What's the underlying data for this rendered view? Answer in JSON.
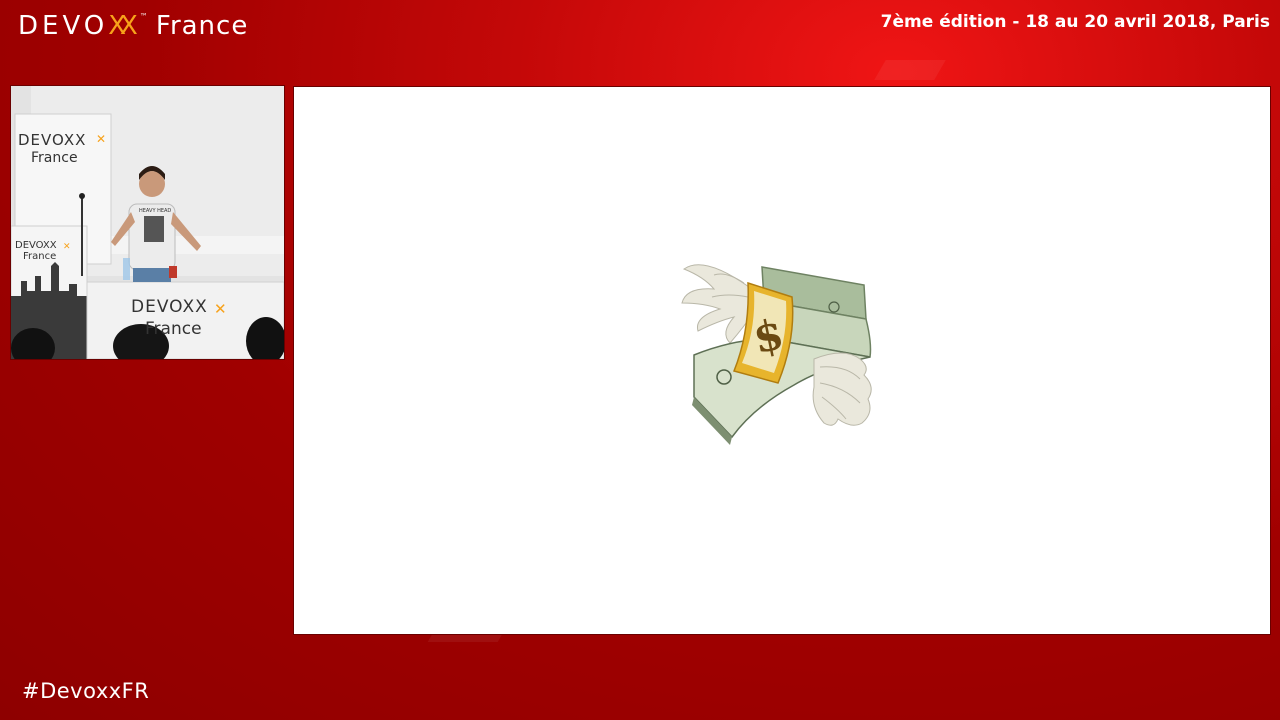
{
  "header": {
    "brand_devo": "DEVO",
    "brand_xx": "XX",
    "brand_tm": "™",
    "brand_france": "France",
    "edition": "7ème édition - 18 au 20 avril 2018, Paris"
  },
  "footer": {
    "hashtag": "#DevoxxFR"
  },
  "camera": {
    "banner_left_devoxx": "DEVOXX",
    "banner_left_france": "France",
    "banner_small_devoxx": "DEVOXX",
    "banner_small_france": "France",
    "banner_table_devoxx": "DEVOXX",
    "banner_table_france": "France",
    "shirt_text": "HEAVY HEAD"
  },
  "slide": {
    "emoji": "money-with-wings-icon"
  },
  "colors": {
    "background": "#a00000",
    "accent": "#f7a21b",
    "slide_bg": "#ffffff"
  }
}
